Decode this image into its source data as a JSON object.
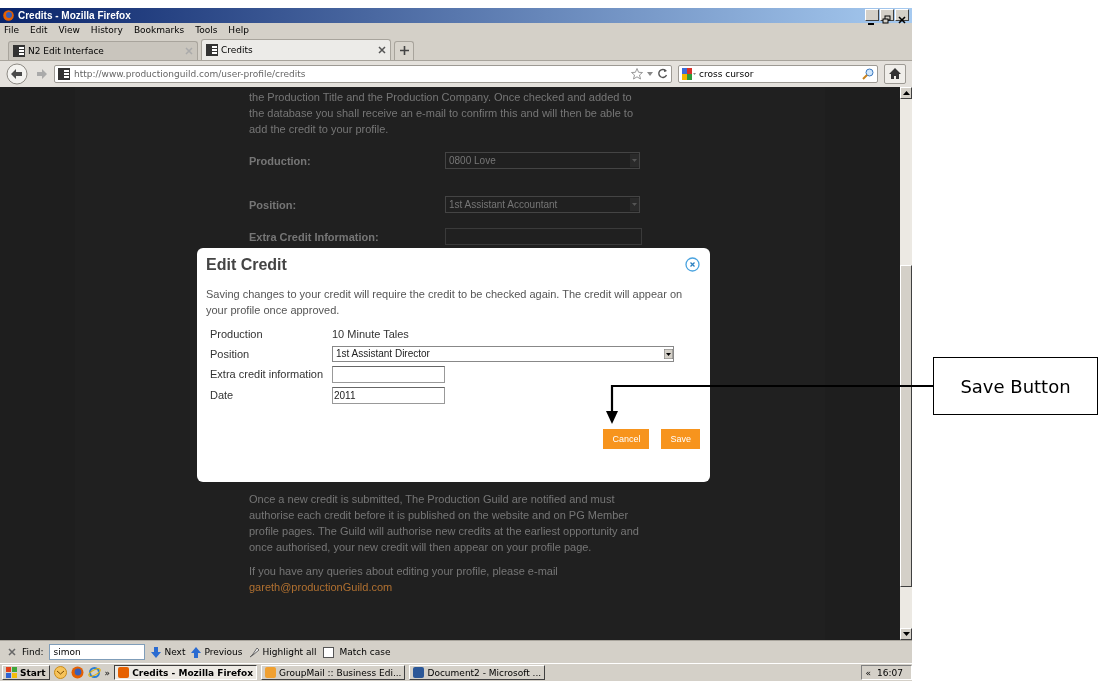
{
  "window": {
    "title": "Credits - Mozilla Firefox"
  },
  "menu": [
    "File",
    "Edit",
    "View",
    "History",
    "Bookmarks",
    "Tools",
    "Help"
  ],
  "tabs": [
    {
      "label": "N2 Edit Interface",
      "selected": false
    },
    {
      "label": "Credits",
      "selected": true
    }
  ],
  "address_bar": {
    "url": "http://www.productionguild.com/user-profile/credits"
  },
  "search": {
    "value": "cross cursor"
  },
  "page": {
    "intro": "the Production Title and the Production Company. Once checked and added to the database you shall receive an e-mail to confirm this and will then be able to add the credit to your profile.",
    "fields": [
      {
        "kind": "select",
        "label": "Production:",
        "value": "0800 Love"
      },
      {
        "kind": "select",
        "label": "Position:",
        "value": "1st Assistant Accountant"
      },
      {
        "kind": "input",
        "label": "Extra Credit Information:"
      }
    ],
    "notice": "Once a new credit is submitted, The Production Guild are notified and must authorise each credit before it is published on the website and on PG Member profile pages. The Guild will authorise new credits at the earliest opportunity and once authorised, your new credit will then appear on your profile page.",
    "contact": "If you have any queries about editing your profile, please e-mail",
    "email": "gareth@productionGuild.com"
  },
  "dialog": {
    "title": "Edit Credit",
    "message": "Saving changes to your credit will require the credit to be checked again. The credit will appear on your profile once approved.",
    "rows": [
      {
        "kind": "text",
        "label": "Production",
        "value": "10 Minute Tales"
      },
      {
        "kind": "select",
        "label": "Position",
        "value": "1st Assistant Director"
      },
      {
        "kind": "input",
        "label": "Extra credit information"
      },
      {
        "kind": "input",
        "label": "Date",
        "value": "2011"
      }
    ],
    "buttons": [
      "Cancel",
      "Save"
    ]
  },
  "find_bar": {
    "label": "Find:",
    "value": "simon",
    "next": "Next",
    "previous": "Previous",
    "highlight_all": "Highlight all",
    "match_case": {
      "label": "Match case",
      "checked": false
    }
  },
  "taskbar": {
    "start": "Start",
    "overflow": "»",
    "tasks": [
      {
        "label": "Credits - Mozilla Firefox",
        "selected": true
      },
      {
        "label": "GroupMail :: Business Edi...",
        "selected": false
      },
      {
        "label": "Document2 - Microsoft ...",
        "selected": false
      }
    ],
    "tray_overflow": "«",
    "clock": "16:07"
  },
  "annotation": {
    "label": "Save Button"
  }
}
